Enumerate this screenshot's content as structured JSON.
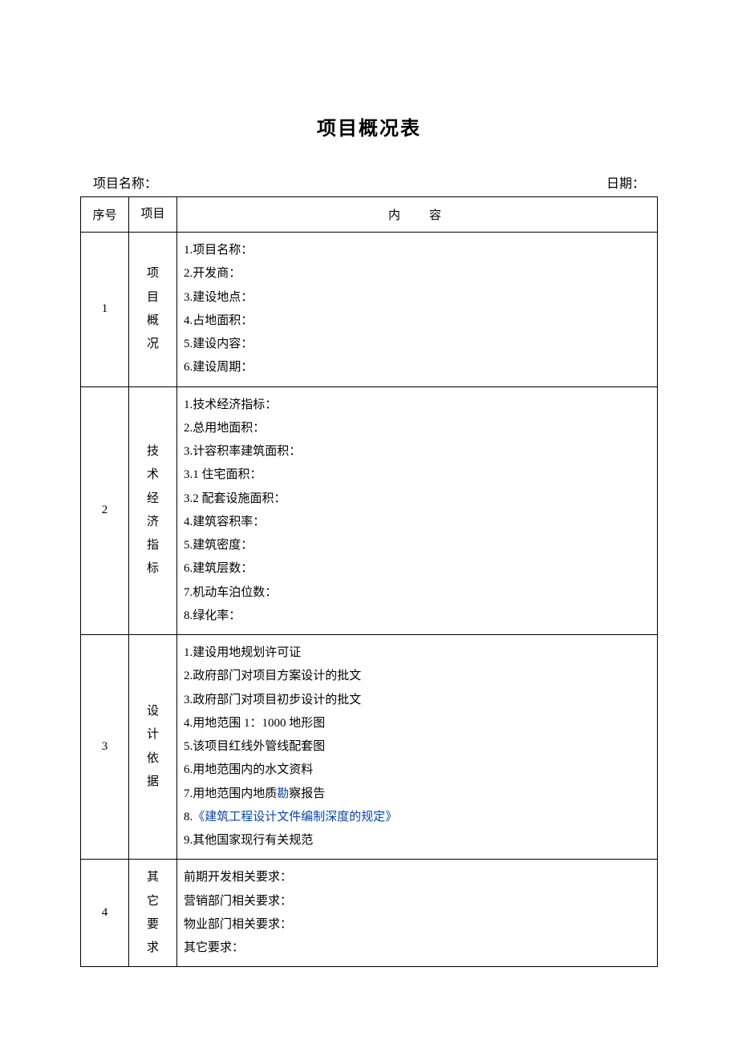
{
  "title": "项目概况表",
  "header": {
    "project_name_label": "项目名称：",
    "date_label": "日期："
  },
  "table": {
    "headers": {
      "seq": "序号",
      "item": "项目",
      "content": "内容"
    },
    "rows": [
      {
        "seq": "1",
        "item": "项目概况",
        "content": [
          "1.项目名称：",
          "2.开发商：",
          "3.建设地点：",
          "4.占地面积：",
          "5.建设内容：",
          "6.建设周期："
        ]
      },
      {
        "seq": "2",
        "item": "技术经济指标",
        "content": [
          "1.技术经济指标：",
          "2.总用地面积：",
          "3.计容积率建筑面积：",
          "3.1 住宅面积：",
          "3.2 配套设施面积：",
          "4.建筑容积率：",
          "5.建筑密度：",
          "6.建筑层数：",
          "7.机动车泊位数：",
          "8.绿化率："
        ]
      },
      {
        "seq": "3",
        "item": "设计依据",
        "content_parts": [
          {
            "text": "1.建设用地规划许可证"
          },
          {
            "text": "2.政府部门对项目方案设计的批文"
          },
          {
            "text": "3.政府部门对项目初步设计的批文"
          },
          {
            "text": "4.用地范围 1：1000 地形图"
          },
          {
            "text": "5.该项目红线外管线配套图"
          },
          {
            "text": "6.用地范围内的水文资料"
          },
          {
            "text_pre": "7.用地范围内地质",
            "link": "勘",
            "text_post": "察报告"
          },
          {
            "text_pre": "8.",
            "link": "《建筑工程设计文件编制深度的规定》",
            "text_post": ""
          },
          {
            "text": "9.其他国家现行有关规范"
          }
        ]
      },
      {
        "seq": "4",
        "item": "其它要求",
        "content": [
          "前期开发相关要求：",
          "营销部门相关要求：",
          "物业部门相关要求：",
          "其它要求："
        ]
      }
    ]
  }
}
